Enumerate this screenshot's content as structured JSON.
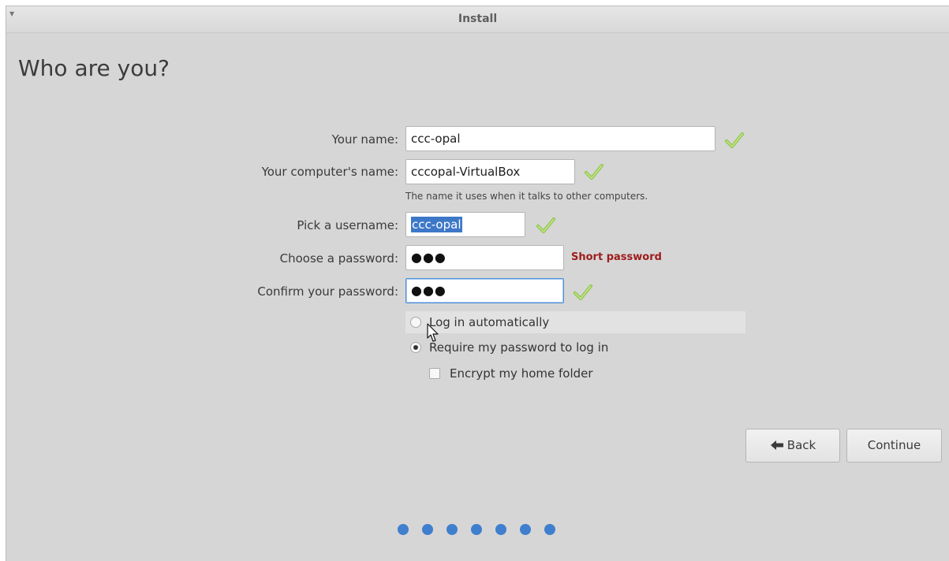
{
  "window": {
    "title": "Install"
  },
  "page": {
    "heading": "Who are you?"
  },
  "form": {
    "name_label": "Your name:",
    "name_value": "ccc-opal",
    "computer_label": "Your computer's name:",
    "computer_value": "cccopal-VirtualBox",
    "computer_hint": "The name it uses when it talks to other computers.",
    "username_label": "Pick a username:",
    "username_value": "ccc-opal",
    "password_label": "Choose a password:",
    "password_value": "●●●",
    "password_error": "Short password",
    "confirm_label": "Confirm your password:",
    "confirm_value": "●●●"
  },
  "options": {
    "auto_login_label": "Log in automatically",
    "auto_login_selected": false,
    "require_password_label": "Require my password to log in",
    "require_password_selected": true,
    "encrypt_label": "Encrypt my home folder",
    "encrypt_checked": false
  },
  "buttons": {
    "back_label": "Back",
    "continue_label": "Continue"
  },
  "progress": {
    "total_steps": 7
  },
  "colors": {
    "accent": "#3f7fcd",
    "error": "#9e1b1b",
    "check": "#8cc63f",
    "selection": "#3d78c8"
  },
  "icons": {
    "valid": "check-icon",
    "back": "arrow-left-icon",
    "menu": "chevron-down-icon",
    "cursor": "mouse-pointer-icon"
  }
}
